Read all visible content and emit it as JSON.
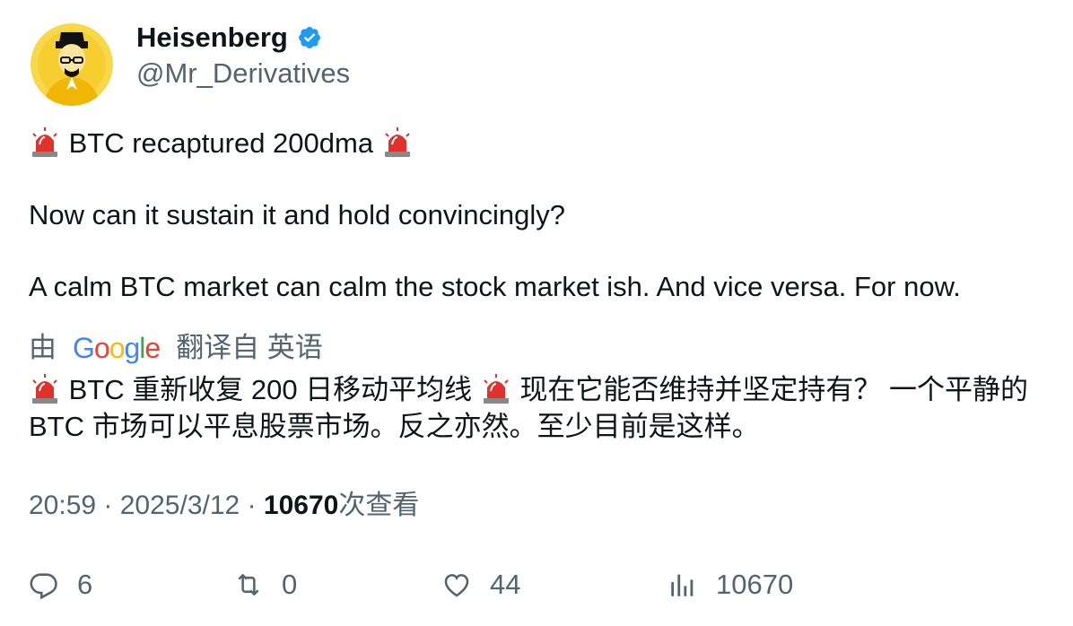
{
  "author": {
    "display_name": "Heisenberg",
    "handle": "@Mr_Derivatives",
    "verified_icon": "verified-badge-icon",
    "avatar_icon": "heisenberg-avatar"
  },
  "tweet": {
    "line1": "BTC recaptured 200dma",
    "line2": "Now can it sustain it and hold convincingly?",
    "line3": "A calm BTC market can calm the stock market ish. And vice versa. For now."
  },
  "translation": {
    "by_prefix": "由",
    "provider": "Google",
    "source_label": "翻译自 英语",
    "text_part1": " BTC 重新收复 200 日移动平均线 ",
    "text_part2": " 现在它能否维持并坚定持有？ 一个平静的 BTC 市场可以平息股票市场。反之亦然。至少目前是这样。"
  },
  "meta": {
    "time": "20:59",
    "date": "2025/3/12",
    "views_count": "10670",
    "views_label": "次查看"
  },
  "actions": {
    "replies": "6",
    "retweets": "0",
    "likes": "44",
    "views": "10670"
  },
  "colors": {
    "text": "#0f1419",
    "secondary": "#536471",
    "verified": "#1d9bf0",
    "siren_red": "#e0312b"
  }
}
